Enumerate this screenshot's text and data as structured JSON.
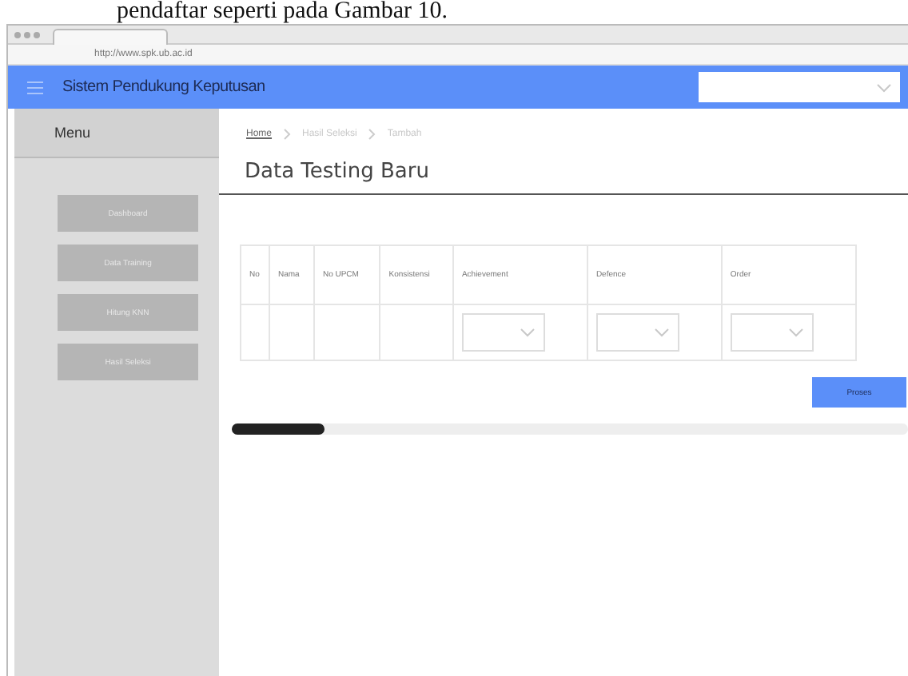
{
  "caption": "pendaftar seperti pada Gambar 10.",
  "browser": {
    "address": "http://www.spk.ub.ac.id"
  },
  "header": {
    "title": "Sistem Pendukung Keputusan"
  },
  "sidebar": {
    "title": "Menu",
    "items": [
      {
        "label": "Dashboard"
      },
      {
        "label": "Data Training"
      },
      {
        "label": "Hitung KNN"
      },
      {
        "label": "Hasil Seleksi"
      }
    ]
  },
  "breadcrumb": [
    {
      "label": "Home",
      "kind": "link"
    },
    {
      "label": "Hasil Seleksi",
      "kind": "text"
    },
    {
      "label": "Tambah",
      "kind": "text"
    }
  ],
  "page_title": "Data Testing Baru",
  "table": {
    "columns": [
      "No",
      "Nama",
      "No UPCM",
      "Konsistensi",
      "Achievement",
      "Defence",
      "Order"
    ],
    "rows": [
      {
        "cells": [
          {
            "kind": "empty"
          },
          {
            "kind": "empty"
          },
          {
            "kind": "empty"
          },
          {
            "kind": "empty"
          },
          {
            "kind": "select"
          },
          {
            "kind": "select"
          },
          {
            "kind": "select"
          }
        ]
      }
    ]
  },
  "button": "Proses"
}
